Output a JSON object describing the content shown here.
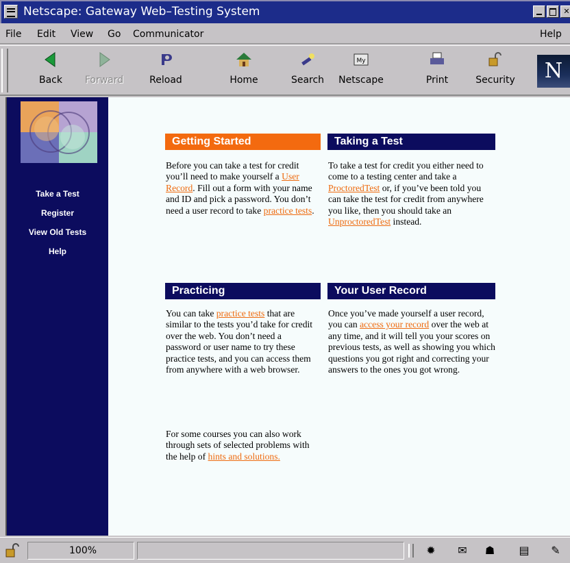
{
  "window": {
    "title": "Netscape: Gateway Web–Testing System"
  },
  "menu": [
    "File",
    "Edit",
    "View",
    "Go",
    "Communicator",
    "Help"
  ],
  "toolbar": {
    "back": "Back",
    "forward": "Forward",
    "reload": "Reload",
    "home": "Home",
    "search": "Search",
    "netscape": "Netscape",
    "print": "Print",
    "security": "Security",
    "logo": "N"
  },
  "sidebar": {
    "links": [
      "Take a Test",
      "Register",
      "View Old Tests",
      "Help"
    ]
  },
  "sections": {
    "getting_started": {
      "title": "Getting Started",
      "t1": "Before you can take a test for credit you’ll need to make yourself a ",
      "link1": "User Record",
      "t2": ". Fill out a form with your name and ID and pick a password. You don’t need a user record to take ",
      "link2": "practice tests",
      "t3": "."
    },
    "taking_a_test": {
      "title": "Taking a Test",
      "t1": "To take a test for credit you either need to come to a testing center and take a ",
      "link1": "ProctoredTest",
      "t2": " or, if you’ve been told you can take the test for credit from anywhere you like, then you should take an ",
      "link2": "UnproctoredTest",
      "t3": " instead."
    },
    "practicing": {
      "title": "Practicing",
      "t1": "You can take ",
      "link1": "practice tests",
      "t2": " that are similar to the tests you’d take for credit over the web. You don’t need a password or user name to try these practice tests, and you can access them from anywhere with a web browser.",
      "p2t1": "For some courses you can also work through sets of selected problems with the help of ",
      "link2": "hints and solutions.",
      "p2t2": ""
    },
    "user_record": {
      "title": "Your User Record",
      "t1": "Once you’ve made yourself a user record, you can ",
      "link1": "access your record",
      "t2": " over the web at any time, and it will tell you your scores on previous tests, as well as showing you which questions you got right and correcting your answers to the ones you got wrong."
    }
  },
  "status": {
    "progress": "100%",
    "message": ""
  },
  "colors": {
    "navy": "#0c0c5e",
    "orange": "#f36a0f",
    "link": "#ee6a0e",
    "page_bg": "#f6fcfc"
  }
}
